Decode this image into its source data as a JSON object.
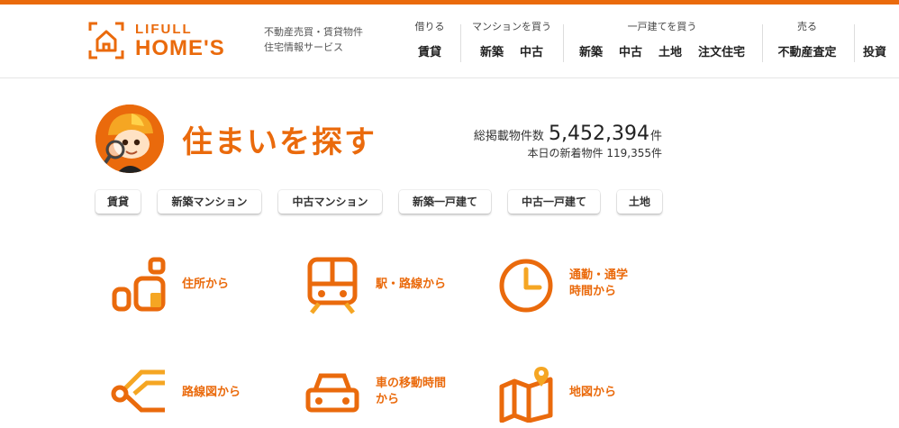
{
  "header": {
    "logo_top": "LIFULL",
    "logo_bottom": "HOME'S",
    "tagline_1": "不動産売買・賃貸物件",
    "tagline_2": "住宅情報サービス",
    "nav": [
      {
        "caption": "借りる",
        "links": [
          "賃貸"
        ]
      },
      {
        "caption": "マンションを買う",
        "links": [
          "新築",
          "中古"
        ]
      },
      {
        "caption": "一戸建てを買う",
        "links": [
          "新築",
          "中古",
          "土地",
          "注文住宅"
        ]
      },
      {
        "caption": "売る",
        "links": [
          "不動産査定"
        ]
      },
      {
        "caption": "",
        "links": [
          "投資"
        ]
      }
    ]
  },
  "hero": {
    "title": "住まいを探す",
    "stats_label": "総掲載物件数",
    "stats_count": "5,452,394",
    "stats_unit": "件",
    "new_label": "本日の新着物件 119,355件"
  },
  "tabs": [
    "賃貸",
    "新築マンション",
    "中古マンション",
    "新築一戸建て",
    "中古一戸建て",
    "土地"
  ],
  "search_methods": [
    {
      "icon": "address-icon",
      "label_1": "住所から",
      "label_2": ""
    },
    {
      "icon": "train-icon",
      "label_1": "駅・路線から",
      "label_2": ""
    },
    {
      "icon": "clock-icon",
      "label_1": "通勤・通学",
      "label_2": "時間から"
    },
    {
      "icon": "route-map-icon",
      "label_1": "路線図から",
      "label_2": ""
    },
    {
      "icon": "car-icon",
      "label_1": "車の移動時間",
      "label_2": "から"
    },
    {
      "icon": "map-icon",
      "label_1": "地図から",
      "label_2": ""
    }
  ],
  "colors": {
    "accent": "#ea6a0c",
    "accent_light": "#f5a623"
  }
}
